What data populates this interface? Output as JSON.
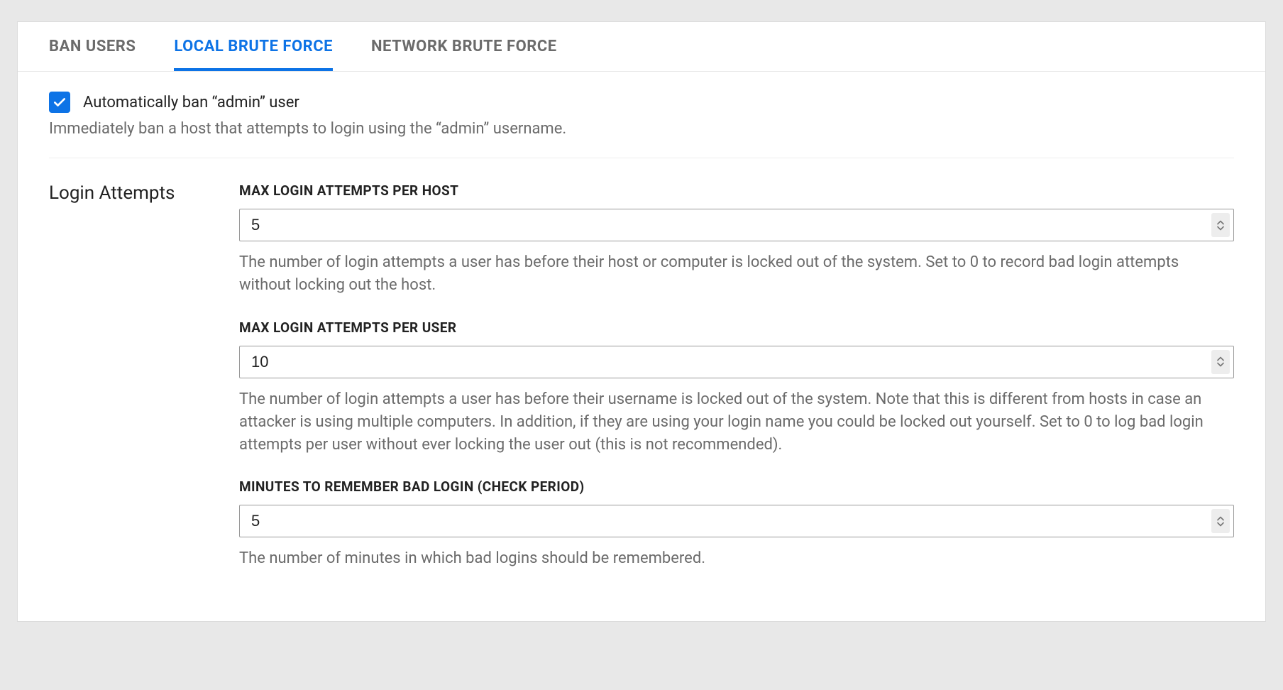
{
  "tabs": {
    "ban_users": "BAN USERS",
    "local_brute_force": "LOCAL BRUTE FORCE",
    "network_brute_force": "NETWORK BRUTE FORCE"
  },
  "auto_ban": {
    "label": "Automatically ban “admin” user",
    "description": "Immediately ban a host that attempts to login using the “admin” username.",
    "checked": true
  },
  "section_title": "Login Attempts",
  "fields": {
    "max_per_host": {
      "label": "MAX LOGIN ATTEMPTS PER HOST",
      "value": "5",
      "description": "The number of login attempts a user has before their host or computer is locked out of the system. Set to 0 to record bad login attempts without locking out the host."
    },
    "max_per_user": {
      "label": "MAX LOGIN ATTEMPTS PER USER",
      "value": "10",
      "description": "The number of login attempts a user has before their username is locked out of the system. Note that this is different from hosts in case an attacker is using multiple computers. In addition, if they are using your login name you could be locked out yourself. Set to 0 to log bad login attempts per user without ever locking the user out (this is not recommended)."
    },
    "minutes_remember": {
      "label": "MINUTES TO REMEMBER BAD LOGIN (CHECK PERIOD)",
      "value": "5",
      "description": "The number of minutes in which bad logins should be remembered."
    }
  }
}
